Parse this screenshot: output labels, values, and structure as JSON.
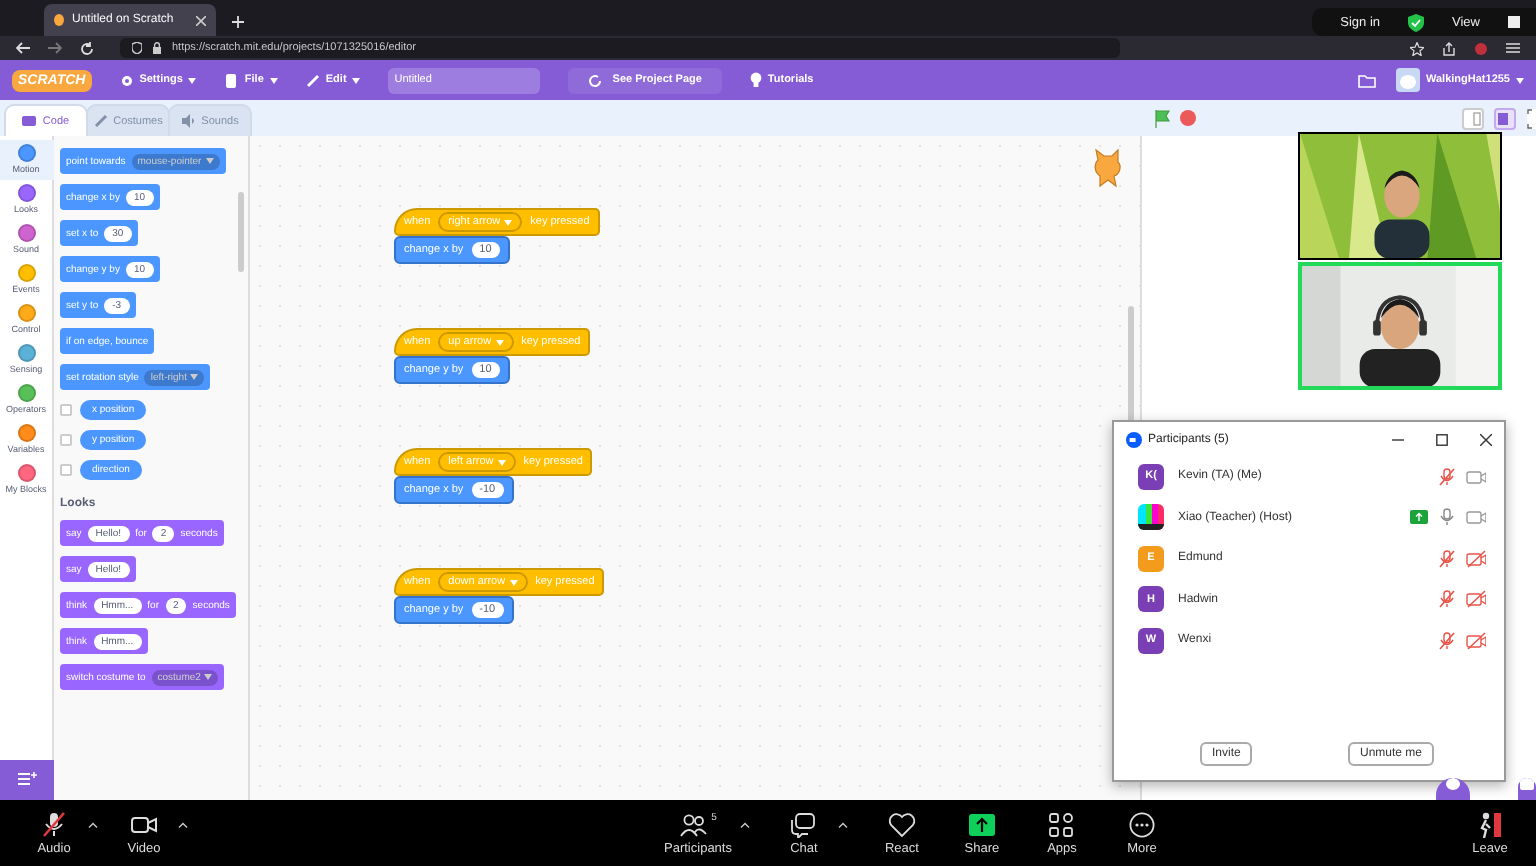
{
  "browser": {
    "tab_title": "Untitled on Scratch",
    "url": "https://scratch.mit.edu/projects/1071325016/editor"
  },
  "zoom_overlay": {
    "sign_in": "Sign in",
    "view": "View"
  },
  "menubar": {
    "logo": "SCRATCH",
    "menus": [
      "Settings",
      "File",
      "Edit"
    ],
    "project_title": "Untitled",
    "see_project": "See Project Page",
    "tutorials": "Tutorials",
    "username": "WalkingHat1255"
  },
  "editor_tabs": [
    {
      "label": "Code",
      "selected": true
    },
    {
      "label": "Costumes",
      "selected": false
    },
    {
      "label": "Sounds",
      "selected": false
    }
  ],
  "categories": [
    {
      "name": "Motion",
      "color": "#4c97ff",
      "selected": true
    },
    {
      "name": "Looks",
      "color": "#9966ff",
      "selected": false
    },
    {
      "name": "Sound",
      "color": "#cf63cf",
      "selected": false
    },
    {
      "name": "Events",
      "color": "#ffbf00",
      "selected": false
    },
    {
      "name": "Control",
      "color": "#ffab19",
      "selected": false
    },
    {
      "name": "Sensing",
      "color": "#5cb1d6",
      "selected": false
    },
    {
      "name": "Operators",
      "color": "#59c059",
      "selected": false
    },
    {
      "name": "Variables",
      "color": "#ff8c1a",
      "selected": false
    },
    {
      "name": "My Blocks",
      "color": "#ff6680",
      "selected": false
    }
  ],
  "palette": [
    {
      "kind": "block",
      "color": "#4c97ff",
      "parts": [
        {
          "kind": "text",
          "text": "point towards"
        },
        {
          "kind": "dropdown",
          "text": "mouse-pointer"
        }
      ]
    },
    {
      "kind": "block",
      "color": "#4c97ff",
      "parts": [
        {
          "kind": "text",
          "text": "change x by"
        },
        {
          "kind": "input",
          "text": "10"
        }
      ]
    },
    {
      "kind": "block",
      "color": "#4c97ff",
      "parts": [
        {
          "kind": "text",
          "text": "set x to"
        },
        {
          "kind": "input",
          "text": "30"
        }
      ]
    },
    {
      "kind": "block",
      "color": "#4c97ff",
      "parts": [
        {
          "kind": "text",
          "text": "change y by"
        },
        {
          "kind": "input",
          "text": "10"
        }
      ]
    },
    {
      "kind": "block",
      "color": "#4c97ff",
      "parts": [
        {
          "kind": "text",
          "text": "set y to"
        },
        {
          "kind": "input",
          "text": "-3"
        }
      ]
    },
    {
      "kind": "block",
      "color": "#4c97ff",
      "parts": [
        {
          "kind": "text",
          "text": "if on edge, bounce"
        }
      ]
    },
    {
      "kind": "block",
      "color": "#4c97ff",
      "parts": [
        {
          "kind": "text",
          "text": "set rotation style"
        },
        {
          "kind": "dropdown",
          "text": "left-right"
        }
      ]
    },
    {
      "kind": "reporter",
      "color": "#4c97ff",
      "checked": false,
      "text": "x position"
    },
    {
      "kind": "reporter",
      "color": "#4c97ff",
      "checked": false,
      "text": "y position"
    },
    {
      "kind": "reporter",
      "color": "#4c97ff",
      "checked": false,
      "text": "direction"
    },
    {
      "kind": "heading",
      "text": "Looks"
    },
    {
      "kind": "block",
      "color": "#9966ff",
      "parts": [
        {
          "kind": "text",
          "text": "say"
        },
        {
          "kind": "input",
          "text": "Hello!"
        },
        {
          "kind": "text",
          "text": "for"
        },
        {
          "kind": "input",
          "text": "2"
        },
        {
          "kind": "text",
          "text": "seconds"
        }
      ]
    },
    {
      "kind": "block",
      "color": "#9966ff",
      "parts": [
        {
          "kind": "text",
          "text": "say"
        },
        {
          "kind": "input",
          "text": "Hello!"
        }
      ]
    },
    {
      "kind": "block",
      "color": "#9966ff",
      "parts": [
        {
          "kind": "text",
          "text": "think"
        },
        {
          "kind": "input",
          "text": "Hmm..."
        },
        {
          "kind": "text",
          "text": "for"
        },
        {
          "kind": "input",
          "text": "2"
        },
        {
          "kind": "text",
          "text": "seconds"
        }
      ]
    },
    {
      "kind": "block",
      "color": "#9966ff",
      "parts": [
        {
          "kind": "text",
          "text": "think"
        },
        {
          "kind": "input",
          "text": "Hmm..."
        }
      ]
    },
    {
      "kind": "block",
      "color": "#9966ff",
      "parts": [
        {
          "kind": "text",
          "text": "switch costume to"
        },
        {
          "kind": "dropdown",
          "text": "costume2"
        }
      ]
    }
  ],
  "scripts": [
    {
      "hat": [
        {
          "kind": "text",
          "text": "when"
        },
        {
          "kind": "dropdown",
          "text": "right arrow"
        },
        {
          "kind": "text",
          "text": "key pressed"
        }
      ],
      "action": [
        {
          "kind": "text",
          "text": "change x by"
        },
        {
          "kind": "input",
          "text": "10"
        }
      ]
    },
    {
      "hat": [
        {
          "kind": "text",
          "text": "when"
        },
        {
          "kind": "dropdown",
          "text": "up arrow"
        },
        {
          "kind": "text",
          "text": "key pressed"
        }
      ],
      "action": [
        {
          "kind": "text",
          "text": "change y by"
        },
        {
          "kind": "input",
          "text": "10"
        }
      ]
    },
    {
      "hat": [
        {
          "kind": "text",
          "text": "when"
        },
        {
          "kind": "dropdown",
          "text": "left arrow"
        },
        {
          "kind": "text",
          "text": "key pressed"
        }
      ],
      "action": [
        {
          "kind": "text",
          "text": "change x by"
        },
        {
          "kind": "input",
          "text": "-10"
        }
      ]
    },
    {
      "hat": [
        {
          "kind": "text",
          "text": "when"
        },
        {
          "kind": "dropdown",
          "text": "down arrow"
        },
        {
          "kind": "text",
          "text": "key pressed"
        }
      ],
      "action": [
        {
          "kind": "text",
          "text": "change y by"
        },
        {
          "kind": "input",
          "text": "-10"
        }
      ]
    }
  ],
  "video_tiles": [
    {
      "kind": "picture",
      "speaking": false
    },
    {
      "kind": "picture",
      "speaking": true
    }
  ],
  "participants": {
    "title": "Participants (5)",
    "people": [
      {
        "name": "Kevin (TA) (Me)",
        "avatar": {
          "kind": "initials",
          "text": "K(",
          "color": "#7b3fb5"
        },
        "sharing": false,
        "muted": true,
        "video_off": false
      },
      {
        "name": "Xiao (Teacher) (Host)",
        "avatar": {
          "kind": "picture"
        },
        "sharing": true,
        "muted": false,
        "video_off": false
      },
      {
        "name": "Edmund",
        "avatar": {
          "kind": "initials",
          "text": "E",
          "color": "#f29b1d"
        },
        "sharing": false,
        "muted": true,
        "video_off": true
      },
      {
        "name": "Hadwin",
        "avatar": {
          "kind": "initials",
          "text": "H",
          "color": "#7b3fb5"
        },
        "sharing": false,
        "muted": true,
        "video_off": true
      },
      {
        "name": "Wenxi",
        "avatar": {
          "kind": "initials",
          "text": "W",
          "color": "#7b3fb5"
        },
        "sharing": false,
        "muted": true,
        "video_off": true
      }
    ],
    "buttons": [
      "Invite",
      "Unmute me"
    ]
  },
  "toolbar": {
    "left": [
      {
        "kind": "audio",
        "label": "Audio",
        "muted": true,
        "caret": true
      },
      {
        "kind": "video",
        "label": "Video",
        "caret": true
      }
    ],
    "center": [
      {
        "kind": "participants",
        "label": "Participants",
        "count": "5",
        "caret": true
      },
      {
        "kind": "chat",
        "label": "Chat",
        "caret": true
      },
      {
        "kind": "react",
        "label": "React",
        "caret": false
      },
      {
        "kind": "share",
        "label": "Share",
        "caret": false
      },
      {
        "kind": "apps",
        "label": "Apps",
        "caret": false
      },
      {
        "kind": "more",
        "label": "More",
        "caret": false
      }
    ],
    "right": [
      {
        "kind": "leave",
        "label": "Leave",
        "caret": false
      }
    ]
  }
}
